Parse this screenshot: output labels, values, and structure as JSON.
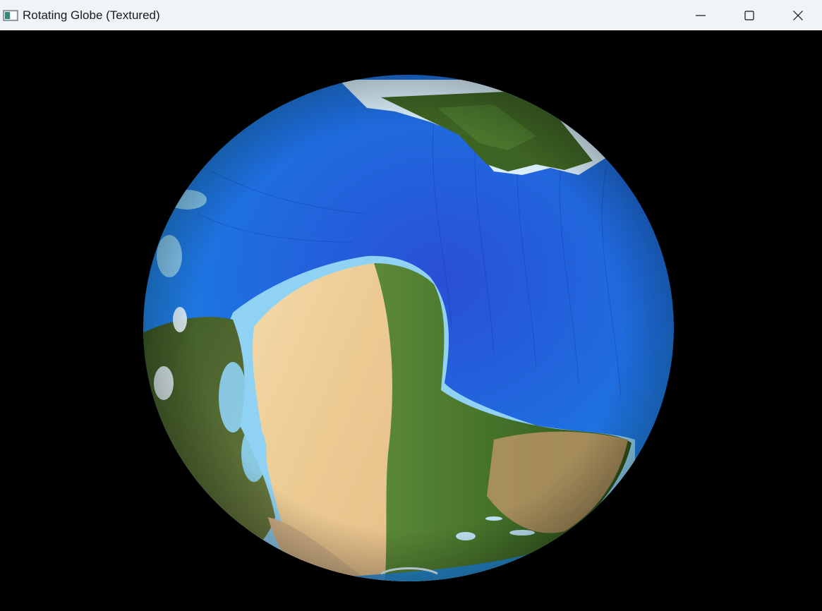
{
  "window": {
    "title": "Rotating Globe (Textured)",
    "icons": {
      "app": "app-window-icon",
      "minimize": "minimize-icon",
      "maximize": "maximize-icon",
      "close": "close-icon"
    }
  },
  "scene": {
    "background_color": "#000000",
    "globe_colors": {
      "ocean_deep": "#1f3fc8",
      "ocean": "#1e78e6",
      "shallow": "#6ec6f2",
      "desert": "#f1d19b",
      "land_green": "#4b7a2e",
      "land_dark": "#2e4a1c",
      "ice": "#d9eefa"
    }
  }
}
